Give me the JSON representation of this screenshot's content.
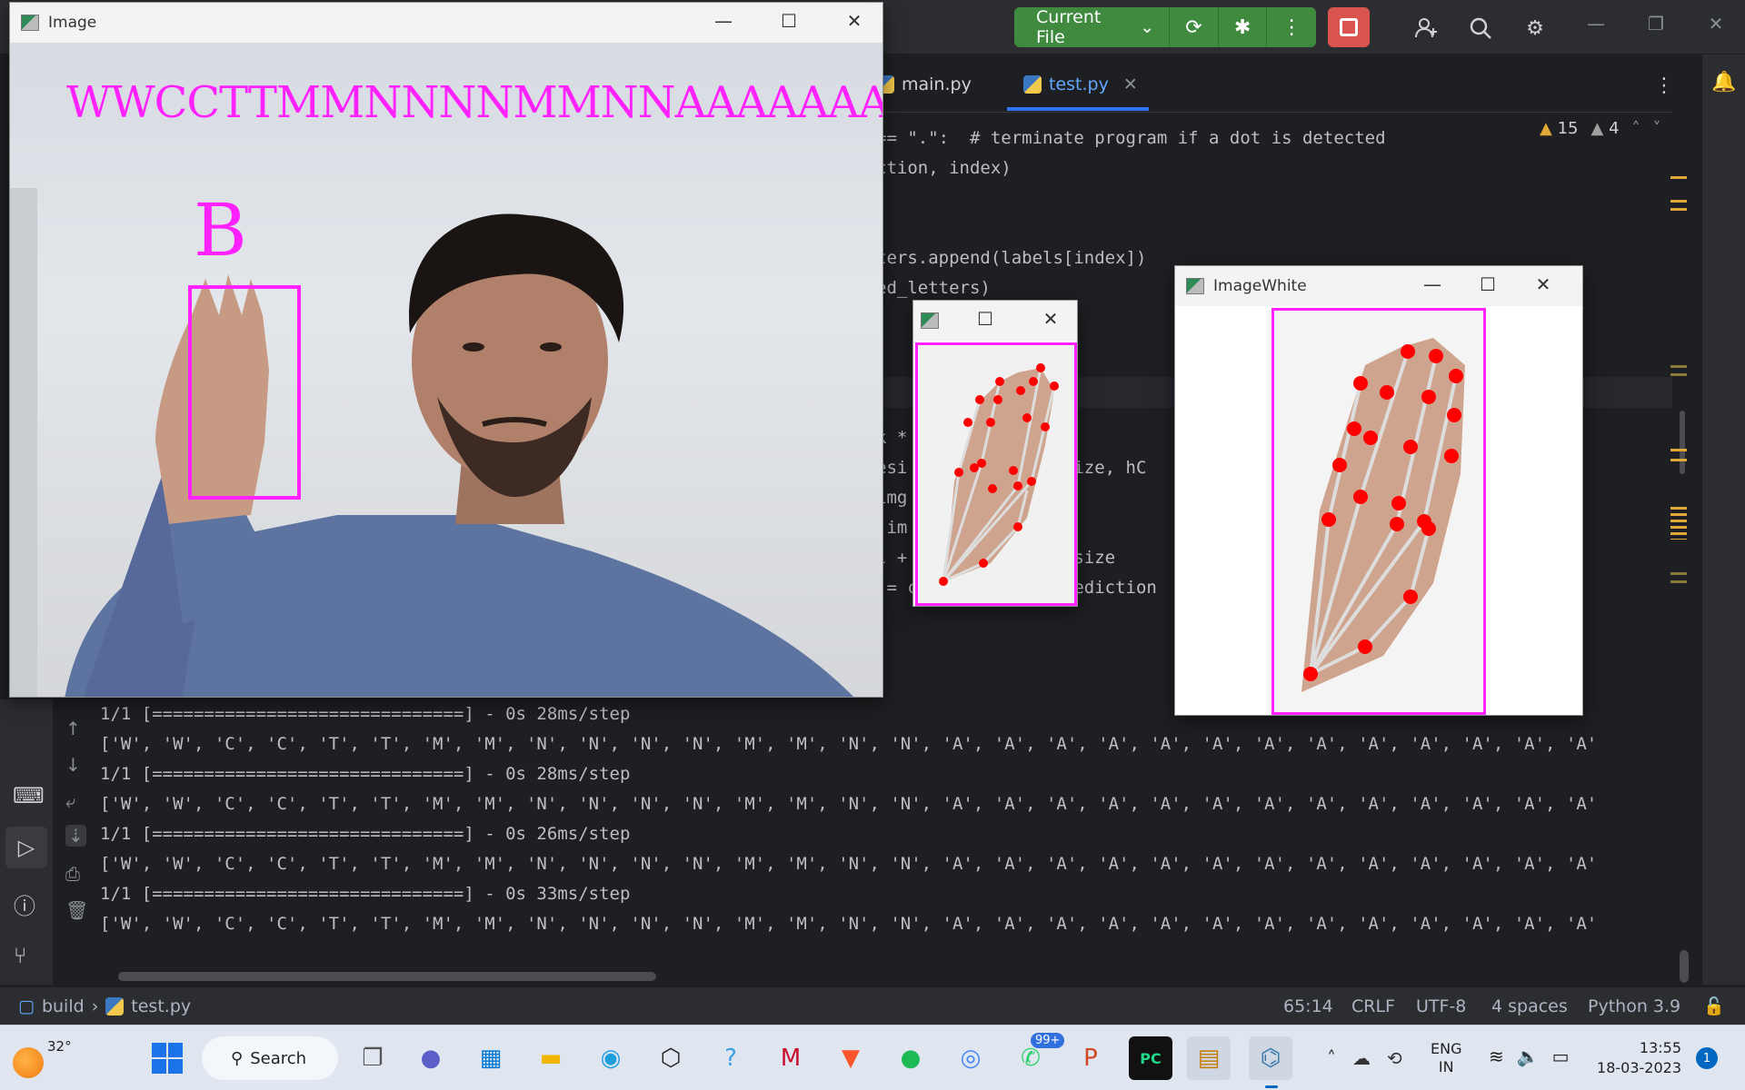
{
  "ide": {
    "run_config_label": "Current File",
    "tabs": [
      {
        "label": "main.py",
        "active": false
      },
      {
        "label": "test.py",
        "active": true
      }
    ],
    "inspections": {
      "warnings": "15",
      "weak_warnings": "4"
    },
    "code_lines": [
      "== \".\":  # terminate program if a dot is detected",
      "ction, index)",
      "",
      "",
      "ters.append(labels[index])",
      "ed_letters)",
      "",
      "",
      "",
      "",
      "k *",
      "esi              gSize, hC",
      "img",
      "(im              2)",
      "l +              Resize",
      " = classifier.getPrediction"
    ],
    "console_lines": [
      "1/1 [==============================] - 0s 28ms/step",
      "['W', 'W', 'C', 'C', 'T', 'T', 'M', 'M', 'N', 'N', 'N', 'N', 'M', 'M', 'N', 'N', 'A', 'A', 'A', 'A', 'A', 'A', 'A', 'A', 'A', 'A', 'A', 'A', 'A'",
      "1/1 [==============================] - 0s 28ms/step",
      "['W', 'W', 'C', 'C', 'T', 'T', 'M', 'M', 'N', 'N', 'N', 'N', 'M', 'M', 'N', 'N', 'A', 'A', 'A', 'A', 'A', 'A', 'A', 'A', 'A', 'A', 'A', 'A', 'A'",
      "1/1 [==============================] - 0s 26ms/step",
      "['W', 'W', 'C', 'C', 'T', 'T', 'M', 'M', 'N', 'N', 'N', 'N', 'M', 'M', 'N', 'N', 'A', 'A', 'A', 'A', 'A', 'A', 'A', 'A', 'A', 'A', 'A', 'A', 'A'",
      "1/1 [==============================] - 0s 33ms/step",
      "['W', 'W', 'C', 'C', 'T', 'T', 'M', 'M', 'N', 'N', 'N', 'N', 'M', 'M', 'N', 'N', 'A', 'A', 'A', 'A', 'A', 'A', 'A', 'A', 'A', 'A', 'A', 'A', 'A'"
    ],
    "breadcrumb": {
      "project": "build",
      "file": "test.py"
    },
    "status": {
      "position": "65:14",
      "line_sep": "CRLF",
      "encoding": "UTF-8",
      "indent": "4 spaces",
      "interpreter": "Python 3.9"
    }
  },
  "image_window": {
    "title": "Image",
    "letters_overlay": "WWCCTTMMNNNNMMNNAAAAAAAAAAAAA",
    "prediction": "B"
  },
  "small_window": {
    "title": ""
  },
  "imagewhite_window": {
    "title": "ImageWhite"
  },
  "taskbar": {
    "weather_temp": "32°",
    "search_label": "Search",
    "whatsapp_badge": "99+",
    "lang_line1": "ENG",
    "lang_line2": "IN",
    "time": "13:55",
    "date": "18-03-2023",
    "notification_count": "1"
  },
  "colors": {
    "magenta": "#ff22ff",
    "landmark": "#ff0000",
    "run_green": "#3f8a3f",
    "stop_red": "#d9534f"
  }
}
